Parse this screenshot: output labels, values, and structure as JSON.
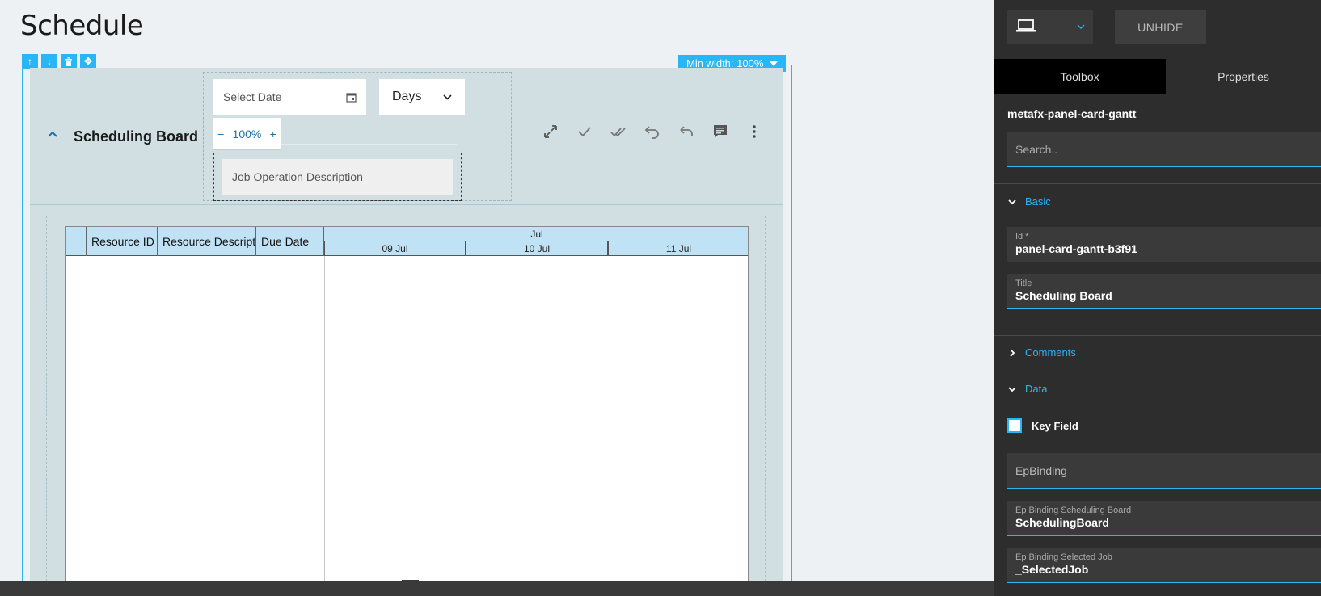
{
  "page": {
    "title": "Schedule"
  },
  "canvas": {
    "min_width_label": "Min width: 100%"
  },
  "card": {
    "title": "Scheduling Board",
    "date_placeholder": "Select Date",
    "view_mode": "Days",
    "zoom_value": "100%",
    "zoom_minus": "−",
    "zoom_plus": "+",
    "job_description_label": "Job Operation Description"
  },
  "gantt": {
    "columns": [
      "Resource ID",
      "Resource Description",
      "Due Date"
    ],
    "month": "Jul",
    "days": [
      "09 Jul",
      "10 Jul",
      "11 Jul"
    ]
  },
  "panel": {
    "unhide_label": "UNHIDE",
    "tabs": [
      "Toolbox",
      "Properties"
    ],
    "component_name": "metafx-panel-card-gantt",
    "search_placeholder": "Search..",
    "sections": {
      "basic": "Basic",
      "comments": "Comments",
      "data": "Data"
    },
    "id_field": {
      "label": "Id *",
      "value": "panel-card-gantt-b3f91"
    },
    "title_field": {
      "label": "Title",
      "value": "Scheduling Board"
    },
    "key_field_label": "Key Field",
    "ep_binding_placeholder": "EpBinding",
    "ep_binding_board": {
      "label": "Ep Binding Scheduling Board",
      "value": "SchedulingBoard"
    },
    "ep_binding_job": {
      "label": "Ep Binding Selected Job",
      "value": "_SelectedJob"
    }
  },
  "colors": {
    "accent": "#29b6f6",
    "panel_bg": "#2d2d2d",
    "card_bg": "#d1dfe3",
    "header_bg": "#bfe2f4"
  }
}
